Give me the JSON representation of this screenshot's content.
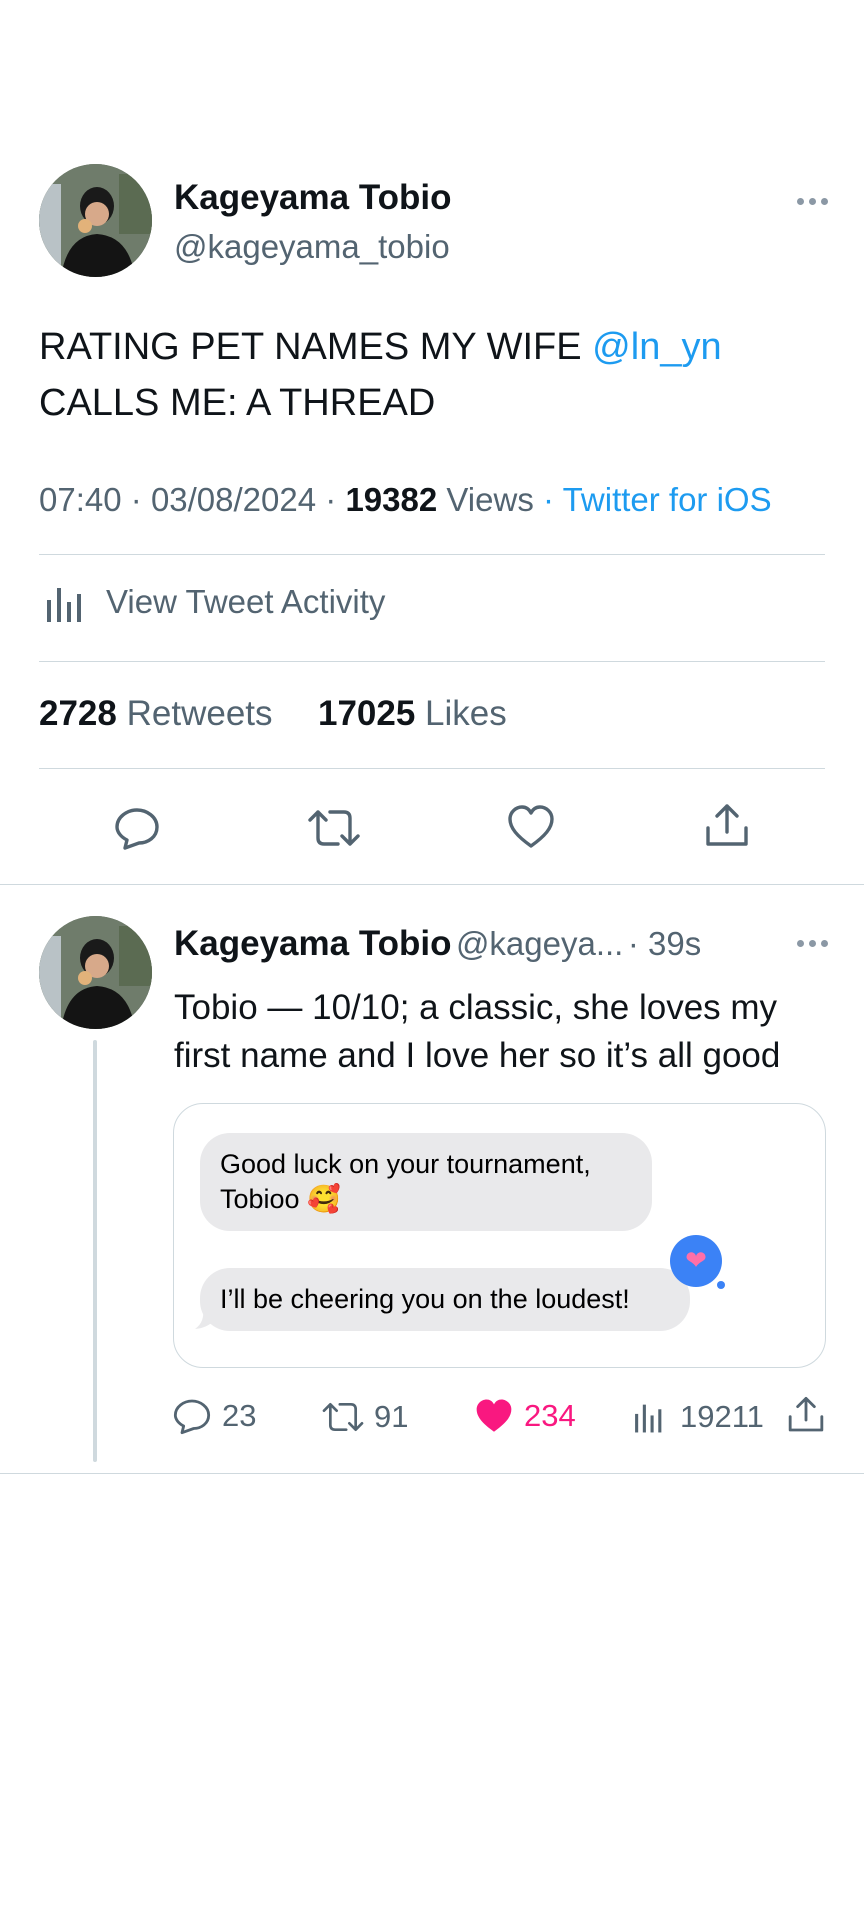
{
  "main_tweet": {
    "author_name": "Kageyama Tobio",
    "author_handle": "@kageyama_tobio",
    "text_before": "RATING PET NAMES MY WIFE ",
    "mention": "@ln_yn",
    "text_after": "CALLS ME: A THREAD",
    "time": "07:40",
    "date": "03/08/2024",
    "views_count": "19382",
    "views_label": "Views",
    "source": "Twitter for iOS",
    "activity_label": "View Tweet Activity",
    "retweets_count": "2728",
    "retweets_label": "Retweets",
    "likes_count": "17025",
    "likes_label": "Likes"
  },
  "reply_tweet": {
    "author_name": "Kageyama Tobio",
    "author_handle": "@kageya...",
    "time_ago": "39s",
    "text": "Tobio — 10/10; a classic, she loves my first name and I love her so it’s all good",
    "message_1": "Good luck on your tournament, Tobioo 🥰",
    "message_2": "I’ll be cheering you on the loudest!",
    "reaction": "❤",
    "replies": "23",
    "retweets": "91",
    "likes": "234",
    "views": "19211"
  },
  "colors": {
    "accent": "#1d9bf0",
    "like": "#f91880",
    "secondary_text": "#536471",
    "divider": "#cfd9de",
    "imessage_blue": "#3b82f6"
  },
  "icons": {
    "more": "more-horizontal-icon",
    "chart": "bar-chart-icon",
    "reply": "reply-icon",
    "retweet": "retweet-icon",
    "like": "heart-icon",
    "share": "share-icon"
  }
}
